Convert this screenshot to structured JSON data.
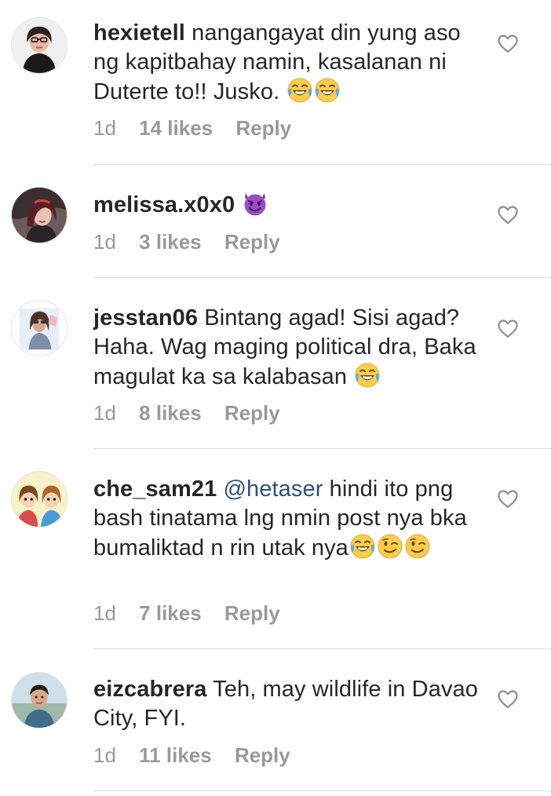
{
  "comments": [
    {
      "username": "hexietell",
      "text": "nangangayat din yung aso ng kapitbahay namin, kasalanan ni Duterte to!! Jusko.",
      "emojis": [
        "face-with-tears-of-joy",
        "face-with-tears-of-joy"
      ],
      "time": "1d",
      "likes": "14 likes",
      "reply": "Reply"
    },
    {
      "username": "melissa.x0x0",
      "text": "",
      "emojis": [
        "smiling-face-with-horns"
      ],
      "time": "1d",
      "likes": "3 likes",
      "reply": "Reply"
    },
    {
      "username": "jesstan06",
      "text": "Bintang agad! Sisi agad? Haha.  Wag maging political dra, Baka magulat ka sa kalabasan",
      "emojis": [
        "face-with-tears-of-joy"
      ],
      "time": "1d",
      "likes": "8 likes",
      "reply": "Reply"
    },
    {
      "username": "che_sam21",
      "mention": "@hetaser",
      "text": "hindi ito png bash tinatama lng nmin post nya bka bumaliktad n rin utak nya",
      "emojis": [
        "face-with-tears-of-joy",
        "winking-face",
        "winking-face"
      ],
      "time": "1d",
      "likes": "7 likes",
      "reply": "Reply"
    },
    {
      "username": "eizcabrera",
      "text": "Teh, may wildlife in Davao City, FYI.",
      "emojis": [],
      "time": "1d",
      "likes": "11 likes",
      "reply": "Reply"
    }
  ],
  "colors": {
    "text": "#262626",
    "meta": "#999999",
    "mention": "#2e4f7f",
    "divider": "#dbdbdb"
  },
  "icons": {
    "like": "heart-outline-icon"
  }
}
